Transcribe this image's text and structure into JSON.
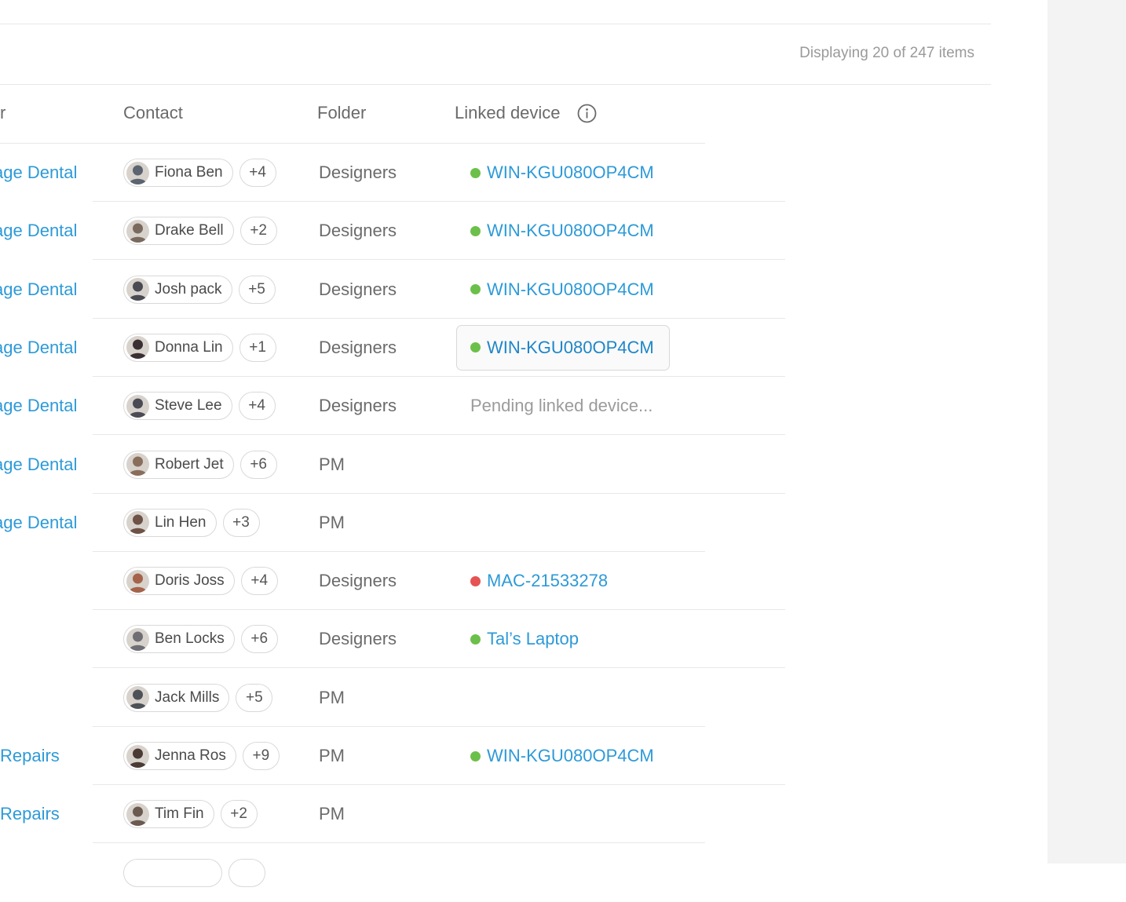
{
  "header": {
    "display_count": "Displaying 20 of 247 items"
  },
  "columns": {
    "customer_fragment": "r",
    "contact": "Contact",
    "folder": "Folder",
    "linked_device": "Linked device"
  },
  "colors": {
    "link": "#2d9ad8",
    "online": "#6cc04a",
    "offline": "#e55353"
  },
  "rows": [
    {
      "customer": "age Dental",
      "contact": "Fiona Ben",
      "more": "+4",
      "folder": "Designers",
      "device": "WIN-KGU080OP4CM",
      "status": "online"
    },
    {
      "customer": "age Dental",
      "contact": "Drake Bell",
      "more": "+2",
      "folder": "Designers",
      "device": "WIN-KGU080OP4CM",
      "status": "online"
    },
    {
      "customer": "age Dental",
      "contact": "Josh pack",
      "more": "+5",
      "folder": "Designers",
      "device": "WIN-KGU080OP4CM",
      "status": "online"
    },
    {
      "customer": "age Dental",
      "contact": "Donna Lin",
      "more": "+1",
      "folder": "Designers",
      "device": "WIN-KGU080OP4CM",
      "status": "online",
      "hovered": true
    },
    {
      "customer": "age Dental",
      "contact": "Steve Lee",
      "more": "+4",
      "folder": "Designers",
      "device": "Pending linked device...",
      "status": "pending"
    },
    {
      "customer": "age Dental",
      "contact": "Robert Jet",
      "more": "+6",
      "folder": "PM",
      "device": "",
      "status": "none"
    },
    {
      "customer": "age Dental",
      "contact": "Lin Hen",
      "more": "+3",
      "folder": "PM",
      "device": "",
      "status": "none"
    },
    {
      "customer": "",
      "contact": "Doris Joss",
      "more": "+4",
      "folder": "Designers",
      "device": "MAC-21533278",
      "status": "offline"
    },
    {
      "customer": "",
      "contact": "Ben Locks",
      "more": "+6",
      "folder": "Designers",
      "device": "Tal’s Laptop",
      "status": "online"
    },
    {
      "customer": "",
      "contact": "Jack Mills",
      "more": "+5",
      "folder": "PM",
      "device": "",
      "status": "none"
    },
    {
      "customer": "Repairs",
      "contact": "Jenna Ros",
      "more": "+9",
      "folder": "PM",
      "device": "WIN-KGU080OP4CM",
      "status": "online"
    },
    {
      "customer": "Repairs",
      "contact": "Tim Fin",
      "more": "+2",
      "folder": "PM",
      "device": "",
      "status": "none"
    }
  ],
  "avatar_colors": [
    "#5b6470",
    "#7a6a5e",
    "#4a4a52",
    "#3a3033",
    "#4b4b55",
    "#8a6e5c",
    "#6d5245",
    "#a4634a",
    "#6e6e74",
    "#4d5259",
    "#4a3b34",
    "#6a5a50"
  ]
}
